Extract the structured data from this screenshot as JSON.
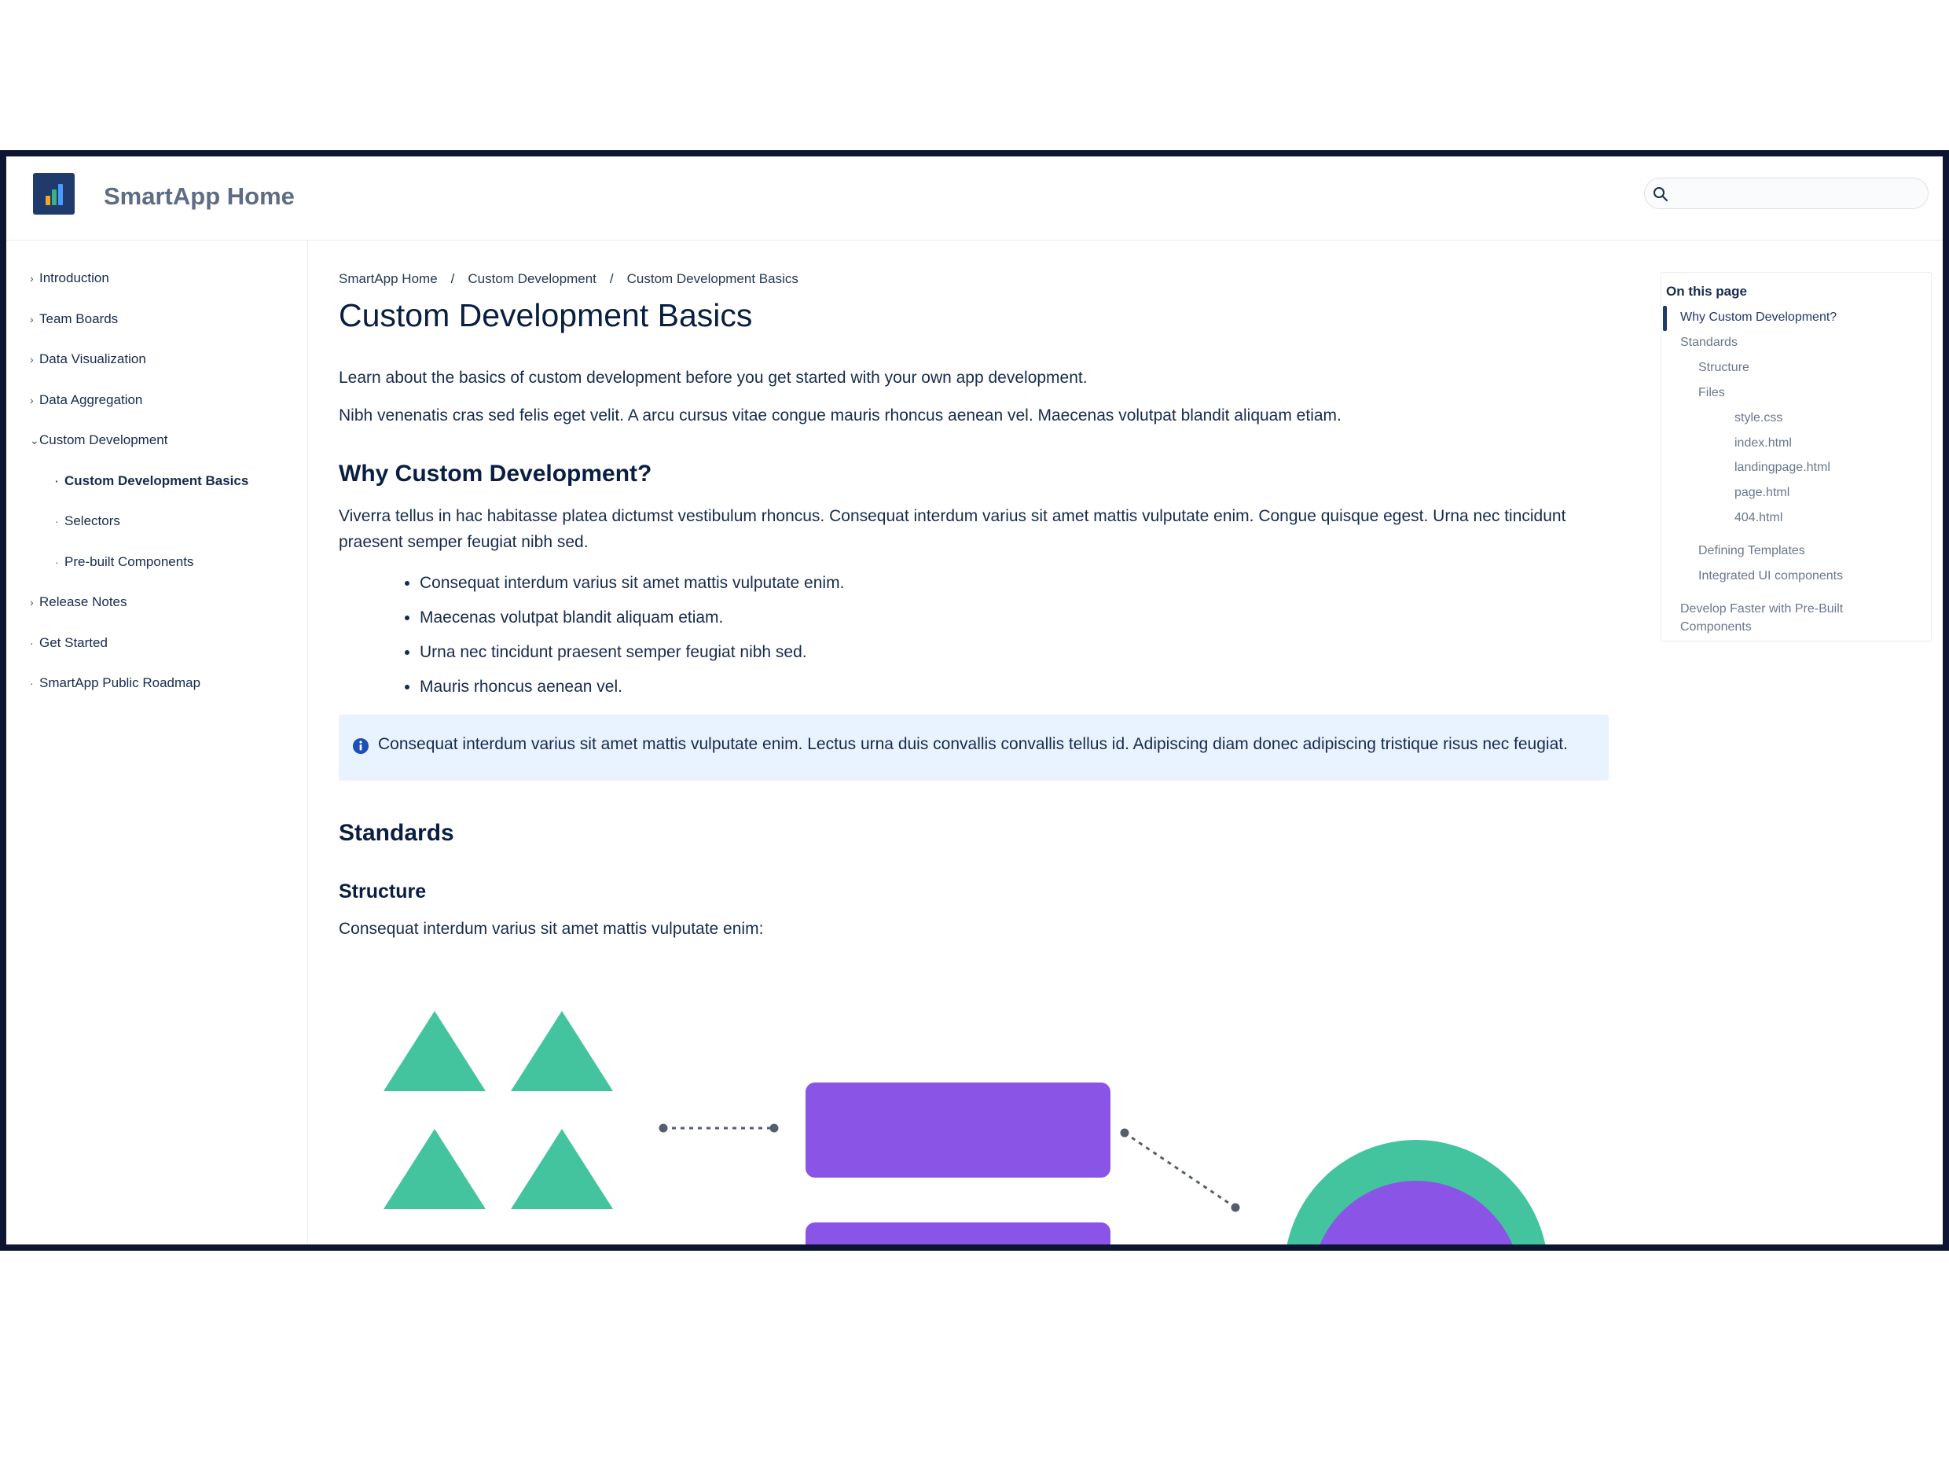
{
  "header": {
    "site_title": "SmartApp Home",
    "search_placeholder": ""
  },
  "sidebar": {
    "items": [
      {
        "label": "Introduction",
        "marker": "›"
      },
      {
        "label": "Team Boards",
        "marker": "›"
      },
      {
        "label": "Data Visualization",
        "marker": "›"
      },
      {
        "label": "Data Aggregation",
        "marker": "›"
      },
      {
        "label": "Custom Development",
        "marker": "⌄"
      },
      {
        "label": "Custom Development Basics",
        "marker": "·"
      },
      {
        "label": "Selectors",
        "marker": "·"
      },
      {
        "label": "Pre-built Components",
        "marker": "·"
      },
      {
        "label": "Release Notes",
        "marker": "›"
      },
      {
        "label": "Get Started",
        "marker": "·"
      },
      {
        "label": "SmartApp Public Roadmap",
        "marker": "·"
      }
    ]
  },
  "breadcrumb": {
    "separator": "/",
    "items": [
      "SmartApp Home",
      "Custom Development",
      "Custom Development Basics"
    ]
  },
  "page": {
    "title": "Custom Development Basics",
    "intro": "Learn about the basics of custom development before you get started with your own app development.",
    "para2": "Nibh venenatis cras sed felis eget velit. A arcu cursus vitae congue mauris rhoncus aenean vel. Maecenas volutpat blandit aliquam etiam.",
    "why_heading": "Why Custom Development?",
    "why_text": "Viverra tellus in hac habitasse platea dictumst vestibulum rhoncus. Consequat interdum varius sit amet mattis vulputate enim. Congue quisque egest. Urna nec tincidunt praesent semper feugiat nibh sed.",
    "bullets": [
      "Consequat interdum varius sit amet mattis vulputate enim.",
      "Maecenas volutpat blandit aliquam etiam.",
      "Urna nec tincidunt praesent semper feugiat nibh sed.",
      "Mauris rhoncus aenean vel."
    ],
    "info_text": "Consequat interdum varius sit amet mattis vulputate enim. Lectus urna duis convallis convallis tellus id. Adipiscing diam donec adipiscing tristique risus nec feugiat.",
    "standards_heading": "Standards",
    "structure_heading": "Structure",
    "structure_text": "Consequat interdum varius sit amet mattis vulputate enim:"
  },
  "toc": {
    "title": "On this page",
    "items": [
      {
        "label": "Why Custom Development?",
        "active": true
      },
      {
        "label": "Standards"
      },
      {
        "label": "Structure"
      },
      {
        "label": "Files"
      },
      {
        "label": "style.css"
      },
      {
        "label": "index.html"
      },
      {
        "label": "landingpage.html"
      },
      {
        "label": "page.html"
      },
      {
        "label": "404.html"
      },
      {
        "label": "Defining Templates"
      },
      {
        "label": "Integrated UI components"
      },
      {
        "label": "Develop Faster with Pre-Built"
      },
      {
        "label": "Components"
      }
    ]
  },
  "colors": {
    "frame": "#0d1533",
    "accent": "#1f3a6b",
    "info_bg": "#e9f2ff",
    "green": "#44c39f",
    "purple": "#8a55e6"
  },
  "icons": {
    "search": "search-icon",
    "info": "info-icon",
    "logo": "bar-chart-logo-icon"
  }
}
